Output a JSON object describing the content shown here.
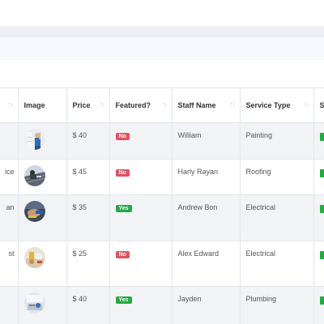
{
  "colors": {
    "no_badge": "#e05260",
    "yes_badge": "#28a745",
    "row_stripe": "#f2f3f5"
  },
  "table": {
    "columns": [
      {
        "label": ""
      },
      {
        "label": "Image"
      },
      {
        "label": "Price"
      },
      {
        "label": "Featured?"
      },
      {
        "label": "Staff Name"
      },
      {
        "label": "Service Type"
      },
      {
        "label": "S"
      }
    ],
    "sort_glyph": "↑↓",
    "rows": [
      {
        "name_fragment": "",
        "image": "painter-photo",
        "price": "$ 40",
        "featured": "No",
        "featured_state": "no",
        "staff": "William",
        "service": "Painting"
      },
      {
        "name_fragment": "ice",
        "image": "roofer-photo",
        "price": "$ 45",
        "featured": "No",
        "featured_state": "no",
        "staff": "Harly Rayan",
        "service": "Roofing"
      },
      {
        "name_fragment": "an",
        "image": "electrician-photo",
        "price": "$ 35",
        "featured": "Yes",
        "featured_state": "yes",
        "staff": "Andrew Bon",
        "service": "Electrical"
      },
      {
        "name_fragment": "st",
        "image": "electrician-tools-photo",
        "price": "$ 25",
        "featured": "No",
        "featured_state": "no",
        "staff": "Alex Edward",
        "service": "Electrical"
      },
      {
        "name_fragment": "",
        "image": "plumber-photo",
        "price": "$ 40",
        "featured": "Yes",
        "featured_state": "yes",
        "staff": "Jayden",
        "service": "Plumbing"
      }
    ]
  }
}
